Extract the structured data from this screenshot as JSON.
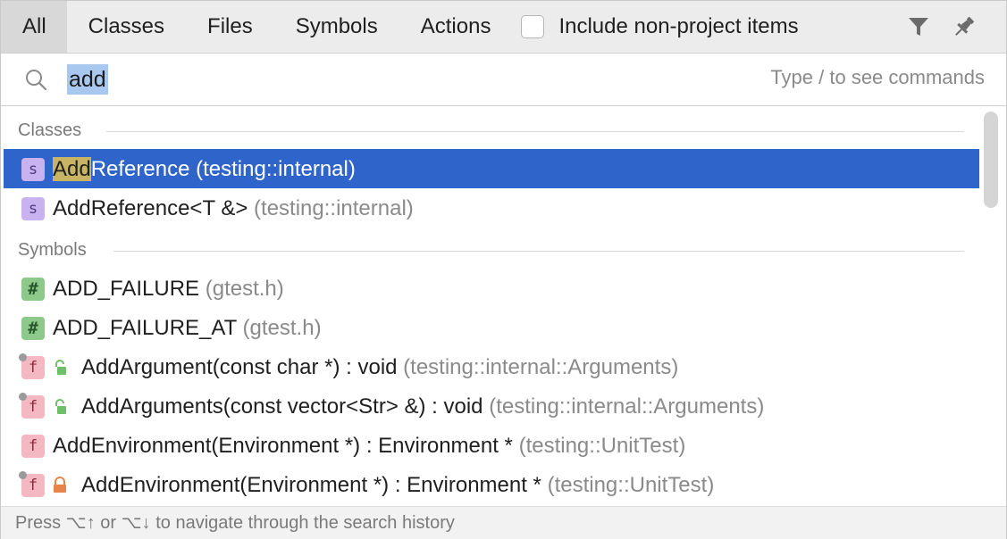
{
  "tabs": [
    "All",
    "Classes",
    "Files",
    "Symbols",
    "Actions"
  ],
  "include_non_project": {
    "label": "Include non-project items",
    "checked": false
  },
  "toolbar": {
    "filter_icon": "filter-icon",
    "pin_icon": "pin-icon"
  },
  "search": {
    "value": "add",
    "hint": "Type / to see commands"
  },
  "sections": {
    "classes": "Classes",
    "symbols": "Symbols"
  },
  "results": {
    "classes": [
      {
        "icon": "s",
        "match": "Add",
        "name": "Reference",
        "location": "(testing::internal)",
        "selected": true
      },
      {
        "icon": "s",
        "name": "AddReference<T &>",
        "location": "(testing::internal)"
      }
    ],
    "symbols": [
      {
        "icon": "#",
        "name": "ADD_FAILURE",
        "location": "(gtest.h)"
      },
      {
        "icon": "#",
        "name": "ADD_FAILURE_AT",
        "location": "(gtest.h)"
      },
      {
        "icon": "f",
        "access": "protected",
        "name": "AddArgument(const char *) : void",
        "location": "(testing::internal::Arguments)"
      },
      {
        "icon": "f",
        "access": "protected",
        "name": "AddArguments(const vector<Str> &) : void",
        "location": "(testing::internal::Arguments)"
      },
      {
        "icon": "f",
        "name": "AddEnvironment(Environment *) : Environment *",
        "location": "(testing::UnitTest)"
      },
      {
        "icon": "f",
        "access": "private",
        "name": "AddEnvironment(Environment *) : Environment *",
        "location": "(testing::UnitTest)"
      }
    ]
  },
  "footer": {
    "text": "Press ⌥↑ or ⌥↓ to navigate through the search history"
  },
  "colors": {
    "selection": "#2f65ca",
    "match_highlight": "#c8b462",
    "protected": "#6fbf6a",
    "private": "#e7844a"
  }
}
